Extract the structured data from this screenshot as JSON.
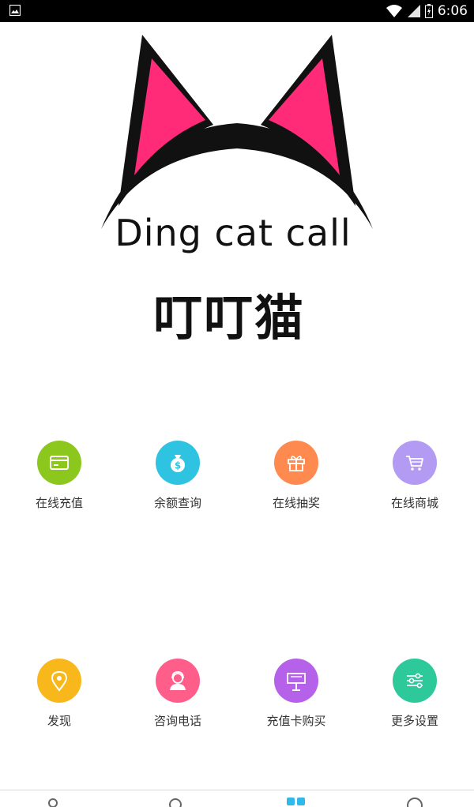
{
  "status_bar": {
    "time": "6:06"
  },
  "logo": {
    "title_en": "Ding cat call",
    "title_cn": "叮叮猫",
    "ear_color": "#ff2a78",
    "ear_outline_color": "#111111"
  },
  "grid": {
    "row1": [
      {
        "label": "在线充值",
        "color": "#8cc71e",
        "icon": "card-icon"
      },
      {
        "label": "余额查询",
        "color": "#2fc3e2",
        "icon": "money-bag-icon"
      },
      {
        "label": "在线抽奖",
        "color": "#ff8a4f",
        "icon": "gift-icon"
      },
      {
        "label": "在线商城",
        "color": "#b39af2",
        "icon": "cart-icon"
      }
    ],
    "row2": [
      {
        "label": "发现",
        "color": "#f8b81c",
        "icon": "location-icon"
      },
      {
        "label": "咨询电话",
        "color": "#ff5e8b",
        "icon": "service-agent-icon"
      },
      {
        "label": "充值卡购买",
        "color": "#b561ea",
        "icon": "billboard-icon"
      },
      {
        "label": "更多设置",
        "color": "#2ec99b",
        "icon": "sliders-icon"
      }
    ]
  },
  "bottom_nav": {
    "active_color": "#2fb8e8",
    "inactive_color": "#666666"
  }
}
